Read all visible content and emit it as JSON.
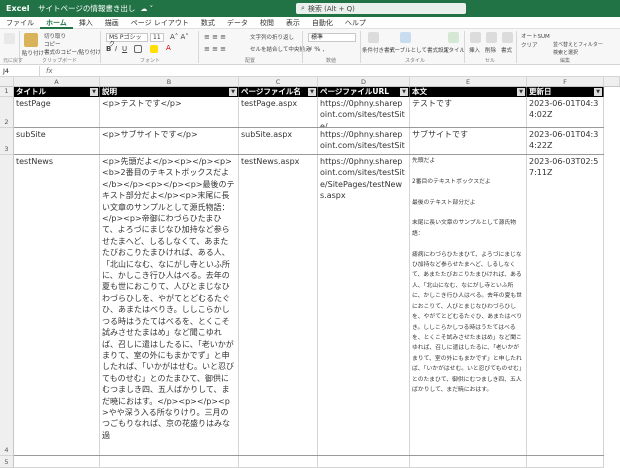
{
  "titlebar": {
    "app": "Excel",
    "doc": "サイトページの情報書き出し",
    "search": "検索 (Alt + Q)",
    "cloud": "☁ ˅"
  },
  "tabs": [
    "ファイル",
    "ホーム",
    "挿入",
    "描画",
    "ページ レイアウト",
    "数式",
    "データ",
    "校閲",
    "表示",
    "自動化",
    "ヘルプ"
  ],
  "ribbon": {
    "paste": "貼り付け",
    "cut": "切り取り",
    "copy": "コピー",
    "format_painter": "書式のコピー/貼り付け",
    "font_name": "MS Pゴシック",
    "font_size": "11",
    "number_format": "標準",
    "wrap": "文字列の折り返し",
    "merge": "セルを結合して中央揃え",
    "cond": "条件付き書式",
    "table": "テーブルとして書式設定",
    "style": "スタイル",
    "insert": "挿入",
    "delete": "削除",
    "format": "書式",
    "autosum": "オートSUM",
    "clear": "クリア",
    "sort": "並べ替えとフィルター",
    "find": "検索と選択",
    "groups": [
      "元に戻す",
      "クリップボード",
      "フォント",
      "配置",
      "数値",
      "スタイル",
      "セル",
      "編集"
    ]
  },
  "formula_bar": {
    "name_box": "J4",
    "fx": "fx"
  },
  "columns": [
    "A",
    "B",
    "C",
    "D",
    "E",
    "F"
  ],
  "rows": [
    "1",
    "2",
    "3",
    "4",
    "5"
  ],
  "headers": [
    "タイトル",
    "説明",
    "ページファイル名",
    "ページファイルURL",
    "本文",
    "更新日"
  ],
  "records": [
    {
      "title": "testPage",
      "desc": "<p>テストです</p>",
      "file": "testPage.aspx",
      "url": "https://0phny.sharepoint.com/sites/testSite/",
      "body": "テストです",
      "updated": "2023-06-01T04:34:02Z"
    },
    {
      "title": "subSite",
      "desc": "<p>サブサイトです</p>",
      "file": "subSite.aspx",
      "url": "https://0phny.sharepoint.com/sites/testSite/",
      "body": "サブサイトです",
      "updated": "2023-06-01T04:34:22Z"
    },
    {
      "title": "testNews",
      "desc": "<p>先頭だよ</p><p></p><p><b>2番目のテキストボックスだよ</b></p><p></p><p>最後のテキスト部分だよ</p><p>末尾に長い文章のサンプルとして源氏物語：</p><p>帝御にわづらひたまひて、よろづにまじなひ加持など参らせたまへど、しるしなくて、あまたたびおこりたまひければ、ある人、「北山になむ、なにがし寺といふ所に、かしこき行ひ人はべる。去年の夏も世におこりて、人びとまじなひわづらひしを、やがてとどむるたぐひ、あまたはべりき。ししこらかしつる時はうたてはべるを、とくこそ試みさせたまはめ」など聞こゆれば、召しに遣はしたるに、「老いかがまりて、室の外にもまかでず」と申したれば、「いかがはせむ。いと忍びてものせむ」とのたまひて、御供にむつましき四、五人ばかりして、まだ暁におはす。</p><p></p><p>やや深う入る所なりけり。三月のつごもりなれば、京の花盛りはみな過",
      "file": "testNews.aspx",
      "url": "https://0phny.sharepoint.com/sites/testSite/SitePages/testNews.aspx",
      "body": "先頭だよ\n\n2番目のテキストボックスだよ\n\n最後のテキスト部分だよ\n\n末尾に長い文章のサンプルとして源氏物語：\n\n瘧病にわづらひたまひて、よろづにまじなひ加持など参らせたまへど、しるしなくて、あまたたびおこりたまひければ、ある人、「北山になむ、なにがし寺といふ所に、かしこき行ひ人はべる。去年の夏も世におこりて、人びとまじなひわづらひしを、やがてとどむるたぐひ、あまたはべりき。ししこらかしつる時はうたてはべるを、とくこそ試みさせたまはめ」など聞こゆれば、召しに遣はしたるに、「老いかがまりて、室の外にもまかでず」と申したれば、「いかがはせむ。いと忍びてものせむ」とのたまひて、御供にむつましき四、五人ばかりして、まだ暁におはす。",
      "updated": "2023-06-03T02:57:11Z"
    }
  ]
}
